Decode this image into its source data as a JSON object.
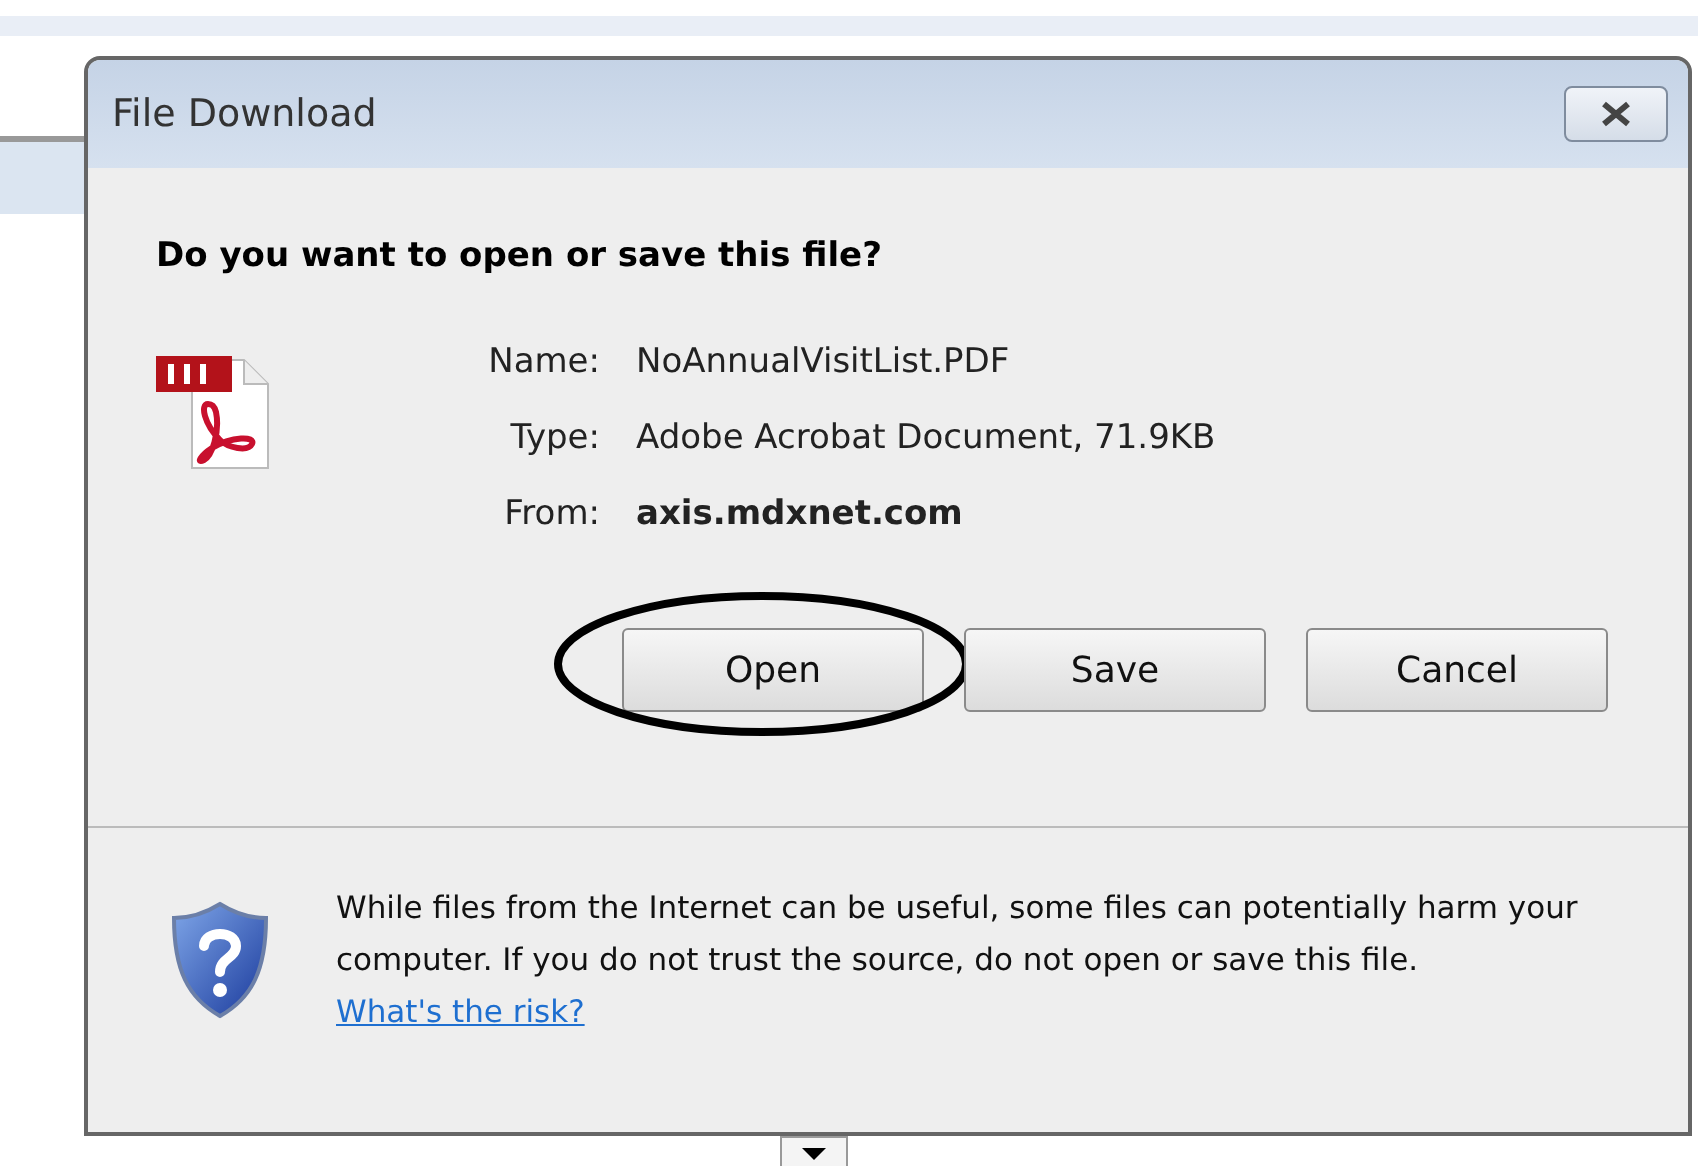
{
  "window": {
    "title": "File Download"
  },
  "question": "Do you want to open or save this file?",
  "file": {
    "kind": "pdf",
    "fields": [
      {
        "label": "Name:",
        "value": "NoAnnualVisitList.PDF",
        "bold": false
      },
      {
        "label": "Type:",
        "value": "Adobe Acrobat Document, 71.9KB",
        "bold": false
      },
      {
        "label": "From:",
        "value": "axis.mdxnet.com",
        "bold": true
      }
    ]
  },
  "buttons": [
    {
      "label": "Open",
      "circled": true
    },
    {
      "label": "Save",
      "circled": false
    },
    {
      "label": "Cancel",
      "circled": false
    }
  ],
  "warning": {
    "text": "While files from the Internet can be useful, some files can potentially harm your computer. If you do not trust the source, do not open or save this file.",
    "link": "What's the risk?"
  }
}
